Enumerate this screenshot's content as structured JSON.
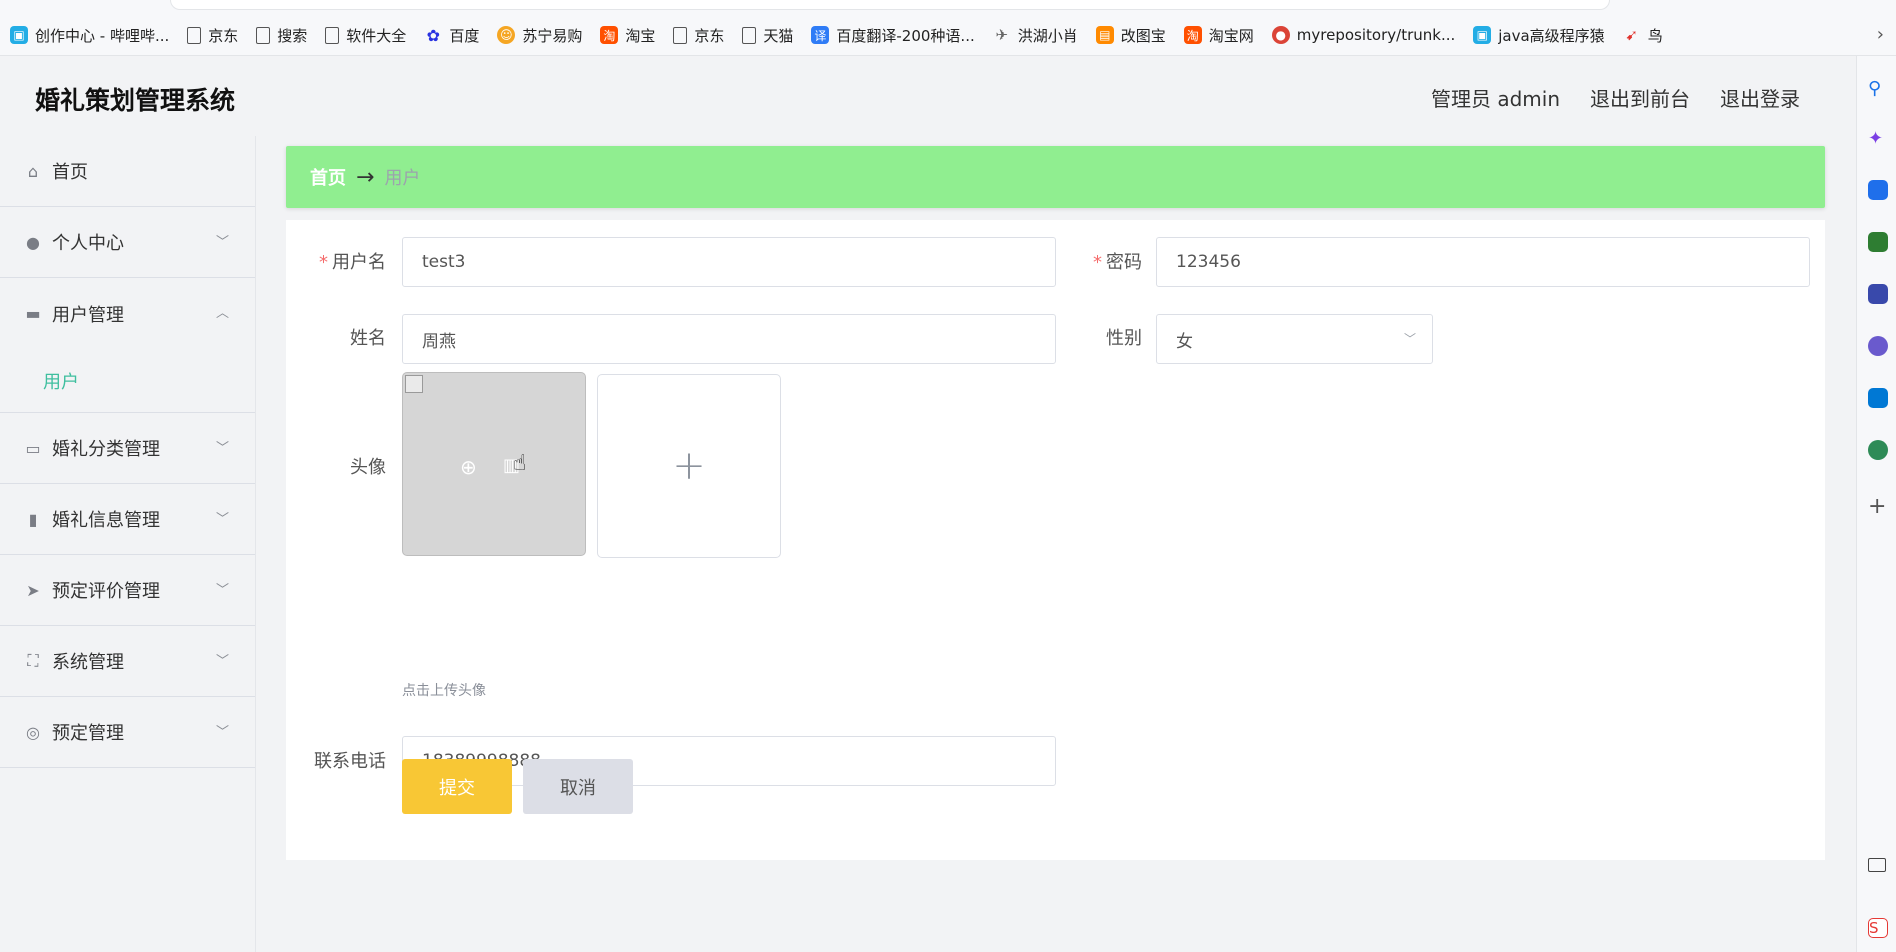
{
  "browser": {
    "bookmarks": [
      {
        "label": "创作中心 - 哔哩哔...",
        "icon": "bilibili-icon",
        "color": "#23ade5"
      },
      {
        "label": "京东",
        "icon": "page-icon",
        "color": "#666666"
      },
      {
        "label": "搜索",
        "icon": "page-icon",
        "color": "#666666"
      },
      {
        "label": "软件大全",
        "icon": "page-icon",
        "color": "#666666"
      },
      {
        "label": "百度",
        "icon": "baidu-paw-icon",
        "color": "#2932e1"
      },
      {
        "label": "苏宁易购",
        "icon": "suning-icon",
        "color": "#f5a623"
      },
      {
        "label": "淘宝",
        "icon": "taobao-icon",
        "color": "#ff5000"
      },
      {
        "label": "京东",
        "icon": "page-icon",
        "color": "#666666"
      },
      {
        "label": "天猫",
        "icon": "page-icon",
        "color": "#666666"
      },
      {
        "label": "百度翻译-200种语...",
        "icon": "translate-icon",
        "color": "#2f7cf6"
      },
      {
        "label": "洪湖小肖",
        "icon": "bird-icon",
        "color": "#666666"
      },
      {
        "label": "改图宝",
        "icon": "gaitubao-icon",
        "color": "#ff8a00"
      },
      {
        "label": "淘宝网",
        "icon": "taobao-icon",
        "color": "#ff5000"
      },
      {
        "label": "myrepository/trunk...",
        "icon": "chrome-icon",
        "color": "#db4437"
      },
      {
        "label": "java高级程序猿",
        "icon": "bilibili-icon",
        "color": "#23ade5"
      },
      {
        "label": "鸟",
        "icon": "bird-red-icon",
        "color": "#e0312b"
      }
    ]
  },
  "app": {
    "title": "婚礼策划管理系统",
    "header_links": [
      "管理员 admin",
      "退出到前台",
      "退出登录"
    ]
  },
  "sidebar": {
    "items": [
      {
        "label": "首页",
        "icon": "home-icon",
        "has_chevron": false
      },
      {
        "label": "个人中心",
        "icon": "user-icon",
        "chevron": "down"
      },
      {
        "label": "用户管理",
        "icon": "chat-icon",
        "chevron": "up"
      },
      {
        "label": "婚礼分类管理",
        "icon": "tray-icon",
        "chevron": "down"
      },
      {
        "label": "婚礼信息管理",
        "icon": "bar-chart-icon",
        "chevron": "down"
      },
      {
        "label": "预定评价管理",
        "icon": "send-icon",
        "chevron": "down"
      },
      {
        "label": "系统管理",
        "icon": "fullscreen-icon",
        "chevron": "down"
      },
      {
        "label": "预定管理",
        "icon": "lifebuoy-icon",
        "chevron": "down"
      }
    ],
    "active_submenu": "用户"
  },
  "breadcrumb": {
    "home": "首页",
    "arrow": "→",
    "current": "用户"
  },
  "form": {
    "username_label": "用户名",
    "username_value": "test3",
    "password_label": "密码",
    "password_value": "123456",
    "name_label": "姓名",
    "name_value": "周燕",
    "gender_label": "性别",
    "gender_value": "女",
    "avatar_label": "头像",
    "avatar_hint": "点击上传头像",
    "phone_label": "联系电话",
    "phone_value": "18389998888",
    "submit_label": "提交",
    "cancel_label": "取消",
    "required_mark": "*"
  },
  "colors": {
    "breadcrumb_bg": "#90ee90",
    "submit_bg": "#f8c735",
    "cancel_bg": "#dcdee6",
    "submenu_active": "#3fbf9f",
    "required": "#f56c6c"
  }
}
